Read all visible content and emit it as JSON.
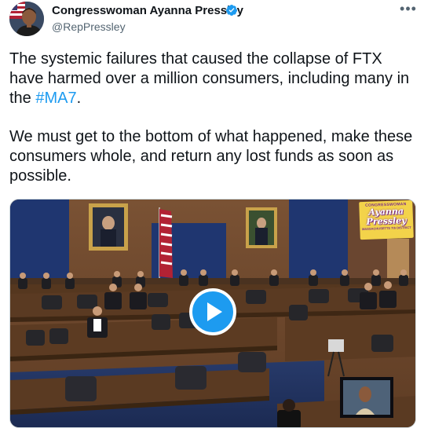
{
  "author": {
    "name": "Congresswoman Ayanna Pressley",
    "handle": "@RepPressley",
    "verified": true
  },
  "menu": {
    "more_label": "•••"
  },
  "tweet": {
    "paragraph1_before": "The systemic failures that caused the collapse of FTX have harmed over a million consumers, including many in the ",
    "hashtag": "#MA7",
    "paragraph1_after": ".",
    "paragraph2": "We must get to the bottom of what happened, make these consumers whole, and return any lost funds as soon as possible."
  },
  "media": {
    "type": "video",
    "logo_overlay": {
      "top_text": "CONGRESSWOMAN",
      "line1": "Ayanna",
      "line2": "Pressley",
      "tagline": "MASSACHUSETTS 7th DISTRICT"
    }
  },
  "colors": {
    "accent": "#1d9bf0",
    "text": "#0f1419",
    "secondary_text": "#536471",
    "border": "#cfd9de"
  },
  "icons": {
    "verified": "verified-badge-icon",
    "play": "play-icon",
    "more": "more-dots-icon"
  }
}
